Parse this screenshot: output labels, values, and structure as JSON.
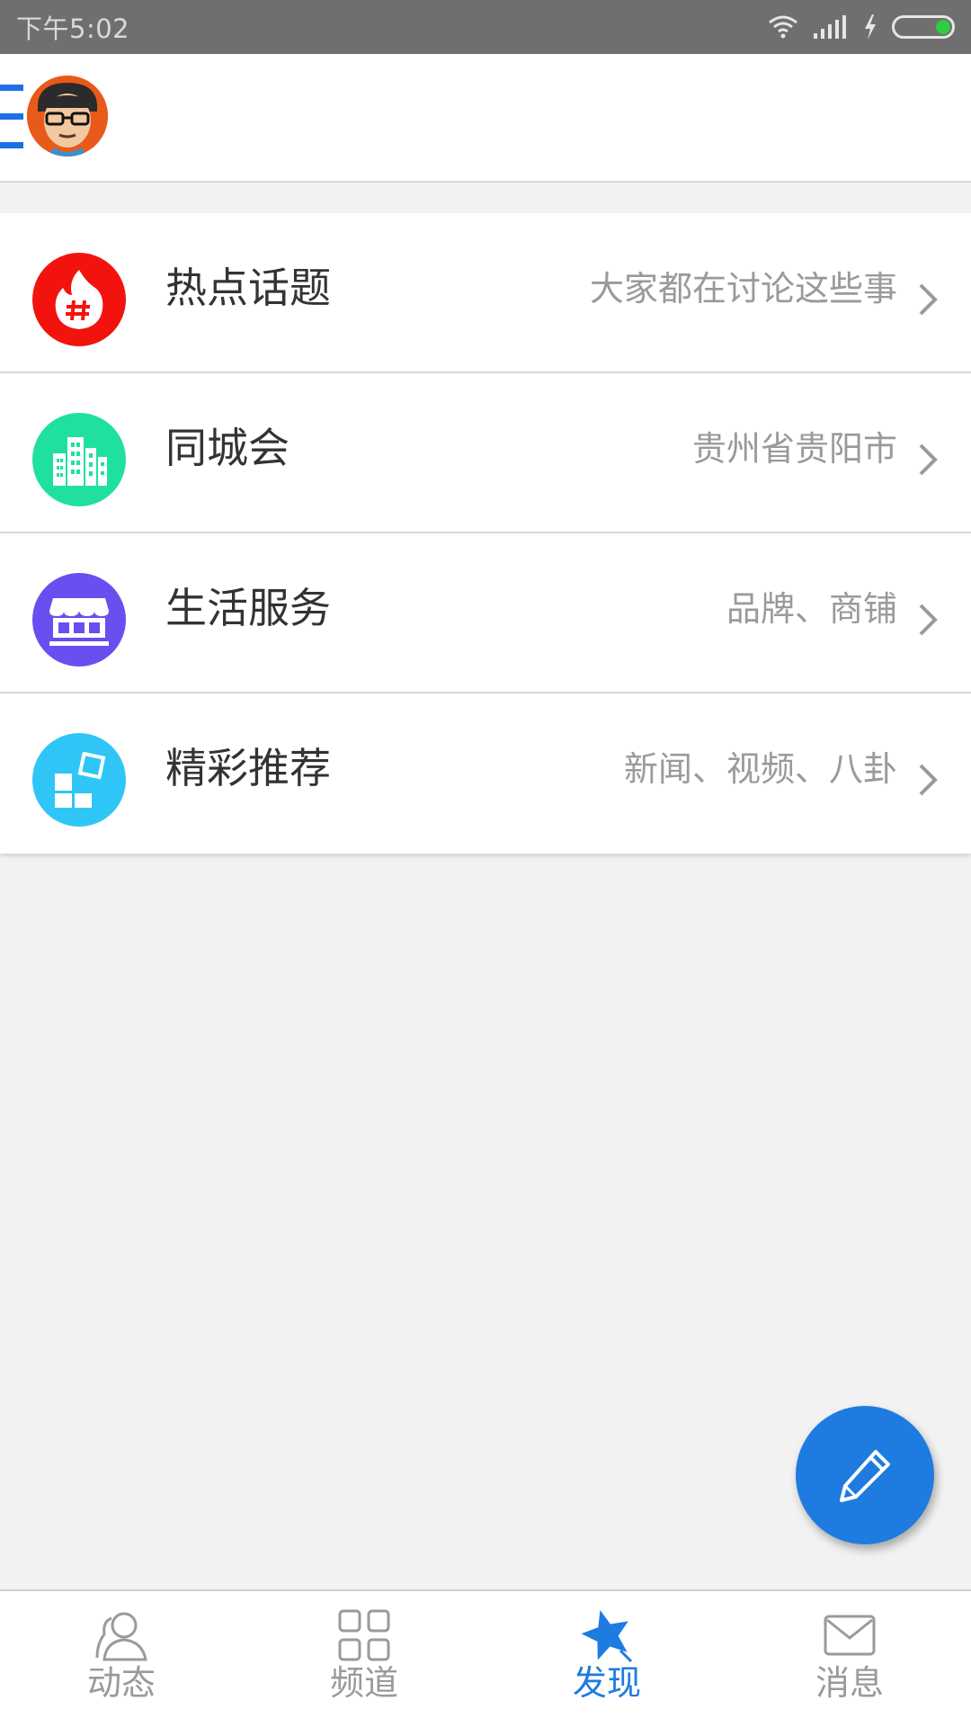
{
  "status_bar": {
    "time": "下午5:02",
    "icons": [
      "wifi-icon",
      "signal-icon",
      "charging-icon",
      "battery-icon"
    ]
  },
  "app_bar": {
    "icons": [
      "menu-icon",
      "avatar"
    ]
  },
  "list": {
    "items": [
      {
        "title": "热点话题",
        "subtitle": "大家都在讨论这些事",
        "icon": "hot-topic-icon",
        "icon_color": "#f2130f"
      },
      {
        "title": "同城会",
        "subtitle": "贵州省贵阳市",
        "icon": "city-icon",
        "icon_color": "#1fe0a0"
      },
      {
        "title": "生活服务",
        "subtitle": "品牌、商铺",
        "icon": "shop-icon",
        "icon_color": "#6b4ef0"
      },
      {
        "title": "精彩推荐",
        "subtitle": "新闻、视频、八卦",
        "icon": "recommend-icon",
        "icon_color": "#2fc6f7"
      }
    ]
  },
  "fab": {
    "icon": "pencil-icon",
    "color": "#1e7be0"
  },
  "bottom_nav": {
    "items": [
      {
        "label": "动态",
        "icon": "person-icon",
        "active": false
      },
      {
        "label": "频道",
        "icon": "grid-icon",
        "active": false
      },
      {
        "label": "发现",
        "icon": "star-icon",
        "active": true
      },
      {
        "label": "消息",
        "icon": "mail-icon",
        "active": false
      }
    ],
    "active_color": "#1e7be0",
    "inactive_color": "#9a9a9a"
  }
}
